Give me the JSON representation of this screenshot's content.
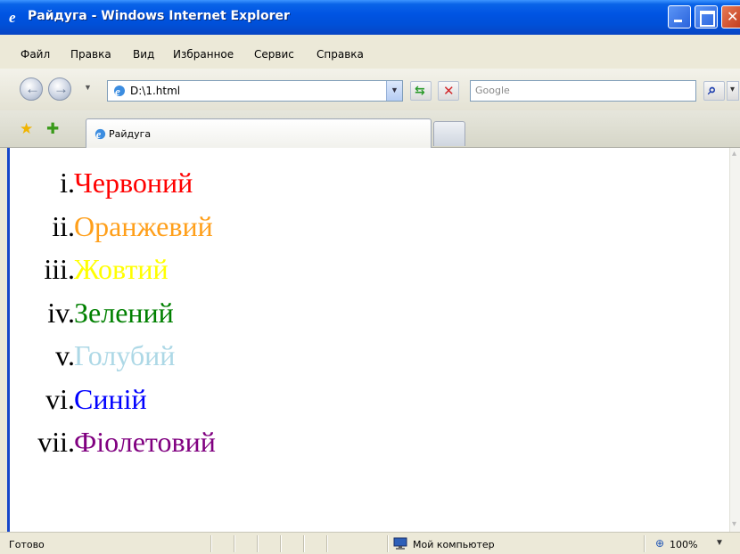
{
  "window": {
    "title": "Райдуга - Windows Internet Explorer"
  },
  "menu": [
    "Файл",
    "Правка",
    "Вид",
    "Избранное",
    "Сервис",
    "Справка"
  ],
  "address": {
    "url": "D:\\1.html"
  },
  "search": {
    "placeholder": "Google"
  },
  "tab": {
    "label": "Райдуга"
  },
  "list": [
    {
      "numeral": "i.",
      "text": "Червоний",
      "color": "#ff0000"
    },
    {
      "numeral": "ii.",
      "text": "Оранжевий",
      "color": "#ff9f1a"
    },
    {
      "numeral": "iii.",
      "text": "Жовтий",
      "color": "#ffff00"
    },
    {
      "numeral": "iv.",
      "text": "Зелений",
      "color": "#008000"
    },
    {
      "numeral": "v.",
      "text": "Голубий",
      "color": "#add8e6"
    },
    {
      "numeral": "vi.",
      "text": "Синій",
      "color": "#0000ff"
    },
    {
      "numeral": "vii.",
      "text": "Фіолетовий",
      "color": "#800080"
    }
  ],
  "status": {
    "text": "Готово",
    "zone": "Мой компьютер",
    "zoom": "100%"
  },
  "icons": {
    "ie": "ie-icon",
    "back": "back-arrow-icon",
    "forward": "forward-arrow-icon",
    "refresh": "refresh-icon",
    "stop": "stop-icon",
    "search": "search-icon",
    "favorites": "star-icon",
    "add_favorite": "add-favorite-icon",
    "computer": "computer-icon",
    "zoom": "zoom-icon"
  }
}
